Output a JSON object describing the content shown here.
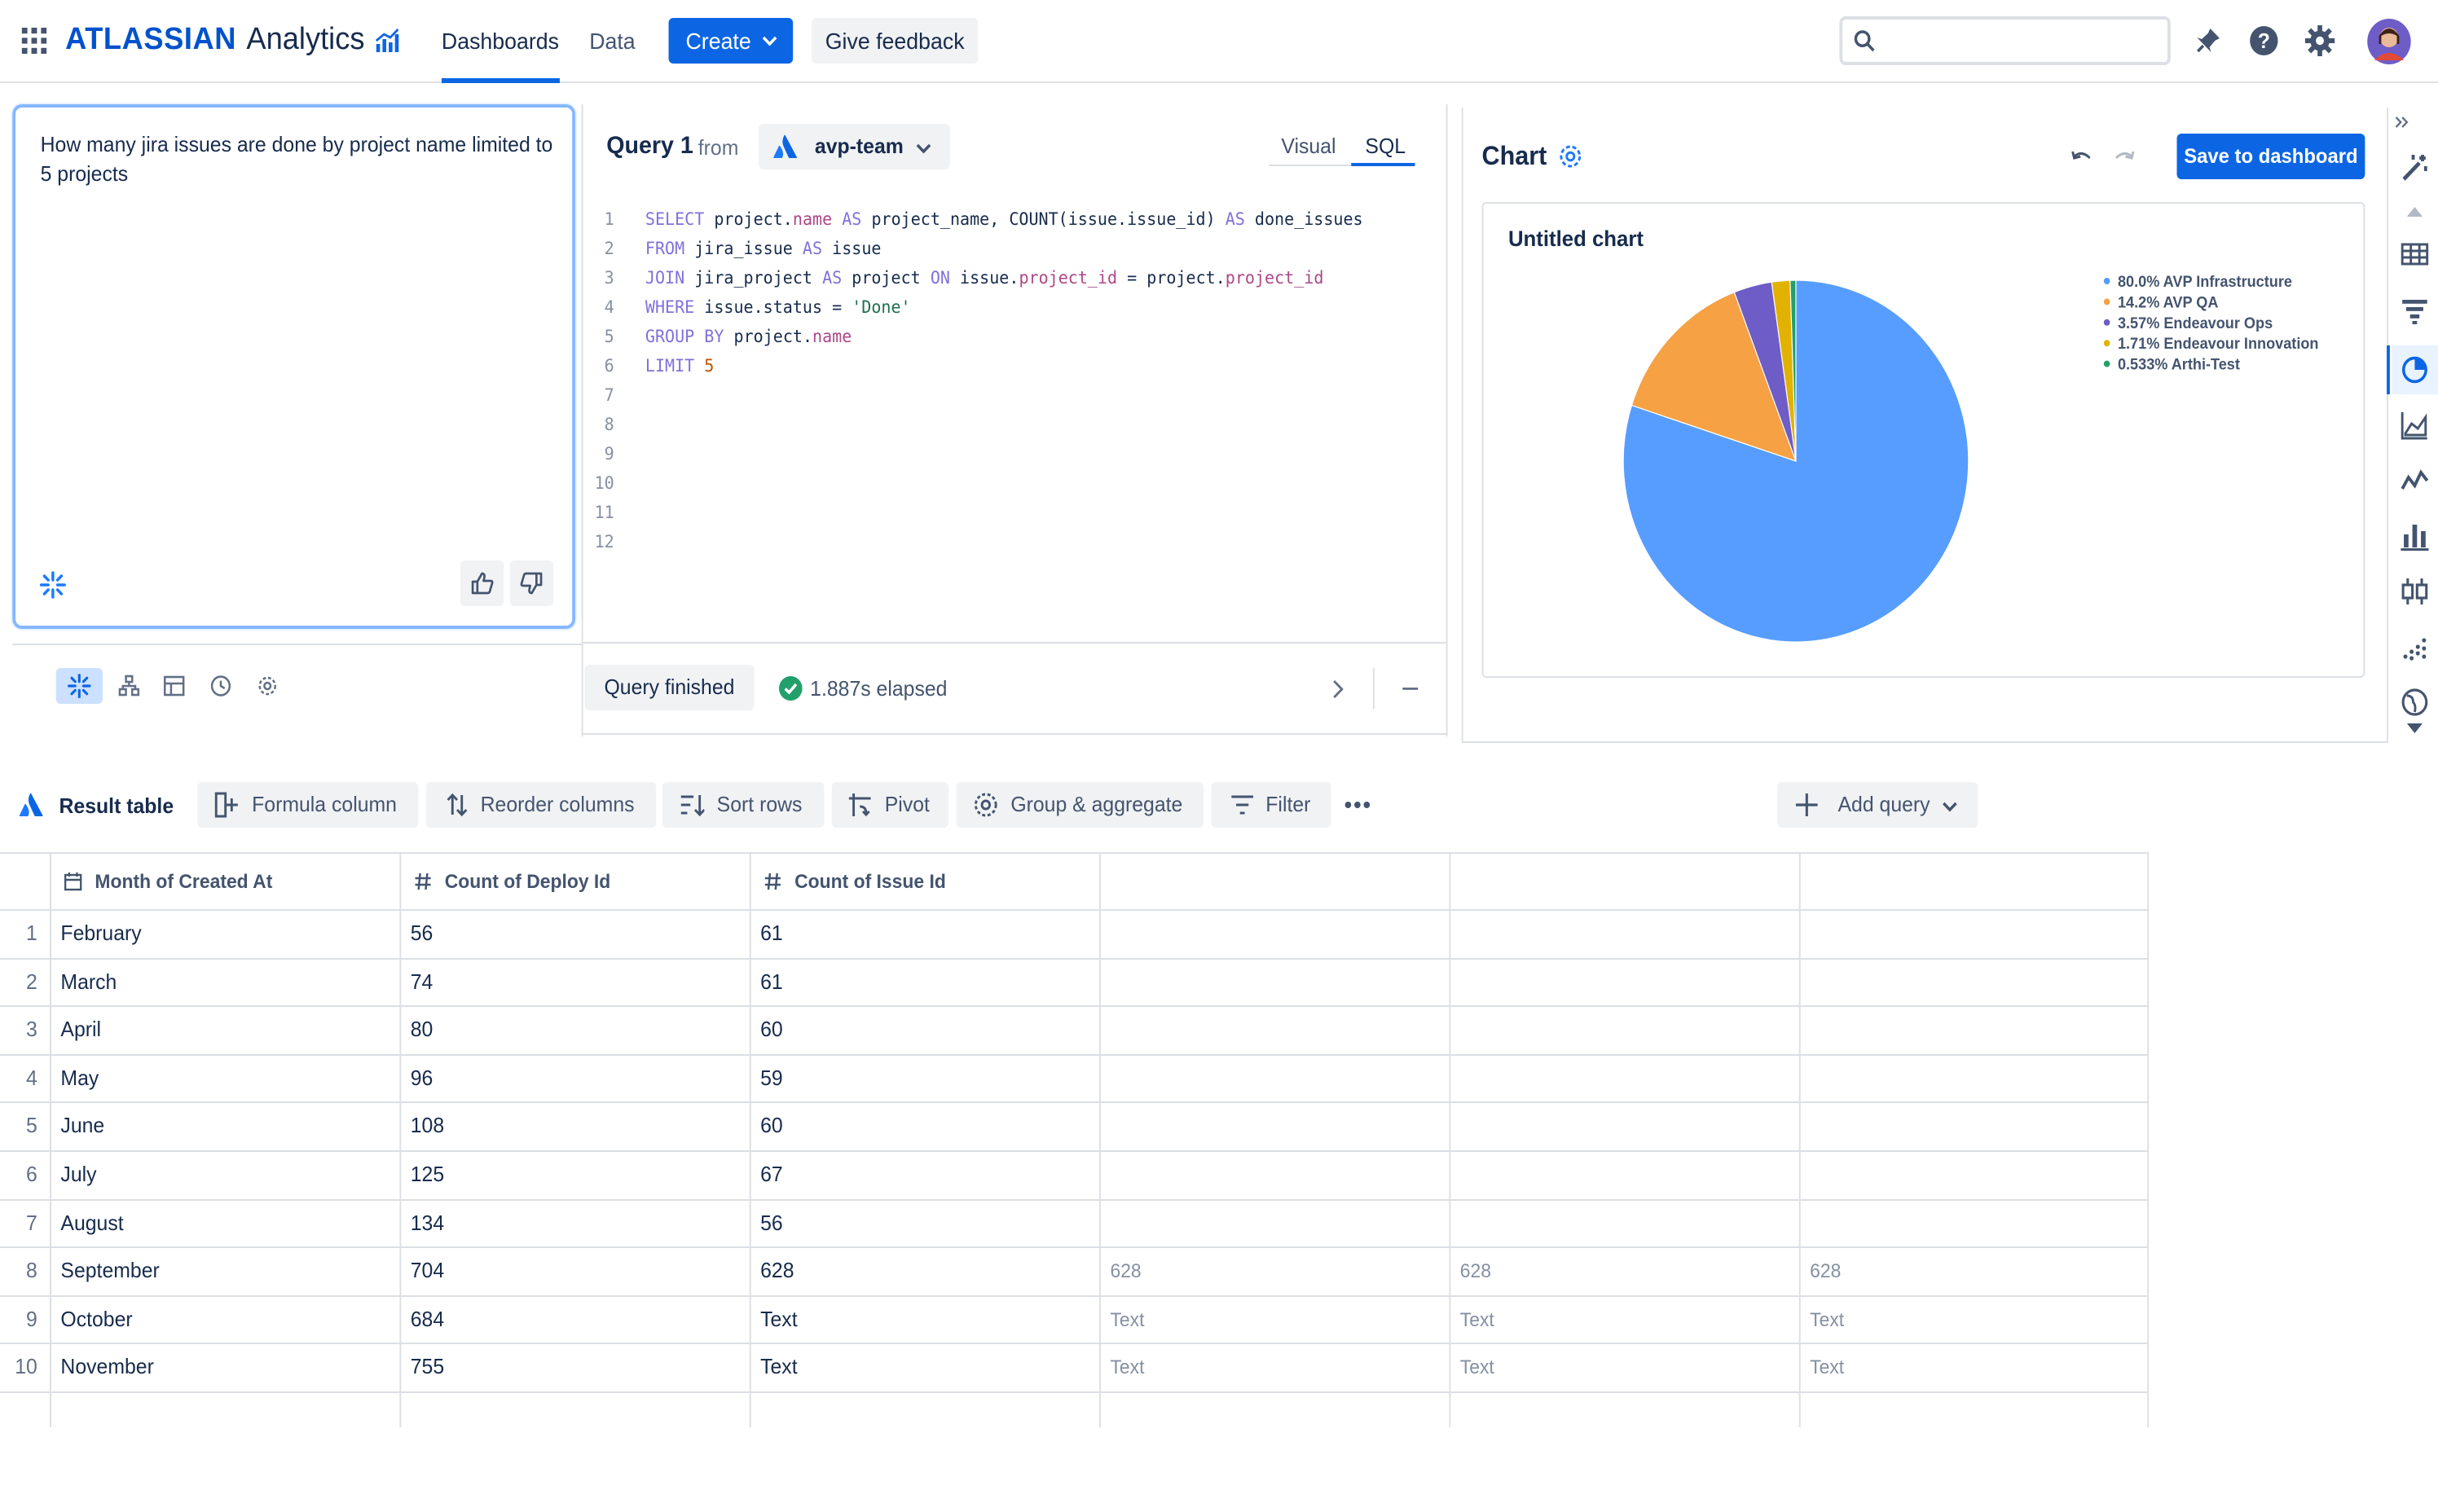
{
  "brand": {
    "name": "ATLASSIAN",
    "product": "Analytics"
  },
  "nav": {
    "tabs": [
      "Dashboards",
      "Data"
    ],
    "create_label": "Create",
    "feedback_label": "Give feedback"
  },
  "search": {
    "placeholder": ""
  },
  "prompt": {
    "text": "How many jira issues are done by project name limited to 5 projects"
  },
  "query": {
    "title": "Query 1",
    "from_label": "from",
    "source": "avp-team",
    "tabs": [
      "Visual",
      "SQL"
    ],
    "active_tab": "SQL",
    "status_label": "Query finished",
    "elapsed": "1.887s elapsed",
    "sql_lines": [
      "SELECT project.name AS project_name, COUNT(issue.issue_id) AS done_issues",
      "FROM jira_issue AS issue",
      "JOIN jira_project AS project ON issue.project_id = project.project_id",
      "WHERE issue.status = 'Done'",
      "GROUP BY project.name",
      "LIMIT 5",
      "",
      "",
      "",
      "",
      "",
      ""
    ],
    "line_numbers": [
      "1",
      "2",
      "3",
      "4",
      "5",
      "6",
      "7",
      "8",
      "9",
      "10",
      "11",
      "12"
    ]
  },
  "chart_panel": {
    "title": "Chart",
    "save_label": "Save to dashboard"
  },
  "chart_data": {
    "type": "pie",
    "title": "Untitled chart",
    "slices": [
      {
        "label": "80.0% AVP Infrastructure",
        "name": "AVP Infrastructure",
        "value": 80.0,
        "color": "#579dff"
      },
      {
        "label": "14.2% AVP QA",
        "name": "AVP QA",
        "value": 14.2,
        "color": "#f5a144"
      },
      {
        "label": "3.57% Endeavour Ops",
        "name": "Endeavour Ops",
        "value": 3.57,
        "color": "#6e5dc6"
      },
      {
        "label": "1.71% Endeavour Innovation",
        "name": "Endeavour Innovation",
        "value": 1.71,
        "color": "#e2b203"
      },
      {
        "label": "0.533% Arthi-Test",
        "name": "Arthi-Test",
        "value": 0.533,
        "color": "#22a06b"
      }
    ],
    "legend_position": "top-right"
  },
  "toolbar": {
    "result_label": "Result table",
    "formula": "Formula column",
    "reorder": "Reorder columns",
    "sort": "Sort rows",
    "pivot": "Pivot",
    "group": "Group & aggregate",
    "filter": "Filter",
    "add_query": "Add query"
  },
  "table": {
    "columns": [
      "Month of Created At",
      "Count of Deploy Id",
      "Count of Issue Id"
    ],
    "rows": [
      {
        "n": "1",
        "month": "February",
        "deploy": "56",
        "issue": "61",
        "extra": [
          "",
          "",
          ""
        ]
      },
      {
        "n": "2",
        "month": "March",
        "deploy": "74",
        "issue": "61",
        "extra": [
          "",
          "",
          ""
        ]
      },
      {
        "n": "3",
        "month": "April",
        "deploy": "80",
        "issue": "60",
        "extra": [
          "",
          "",
          ""
        ]
      },
      {
        "n": "4",
        "month": "May",
        "deploy": "96",
        "issue": "59",
        "extra": [
          "",
          "",
          ""
        ]
      },
      {
        "n": "5",
        "month": "June",
        "deploy": "108",
        "issue": "60",
        "extra": [
          "",
          "",
          ""
        ]
      },
      {
        "n": "6",
        "month": "July",
        "deploy": "125",
        "issue": "67",
        "extra": [
          "",
          "",
          ""
        ]
      },
      {
        "n": "7",
        "month": "August",
        "deploy": "134",
        "issue": "56",
        "extra": [
          "",
          "",
          ""
        ]
      },
      {
        "n": "8",
        "month": "September",
        "deploy": "704",
        "issue": "628",
        "extra": [
          "628",
          "628",
          "628"
        ]
      },
      {
        "n": "9",
        "month": "October",
        "deploy": "684",
        "issue": "Text",
        "extra": [
          "Text",
          "Text",
          "Text"
        ]
      },
      {
        "n": "10",
        "month": "November",
        "deploy": "755",
        "issue": "Text",
        "extra": [
          "Text",
          "Text",
          "Text"
        ]
      }
    ]
  },
  "colors": {
    "primary": "#0c66e4",
    "success": "#22a06b",
    "border": "#dcdfe4"
  }
}
